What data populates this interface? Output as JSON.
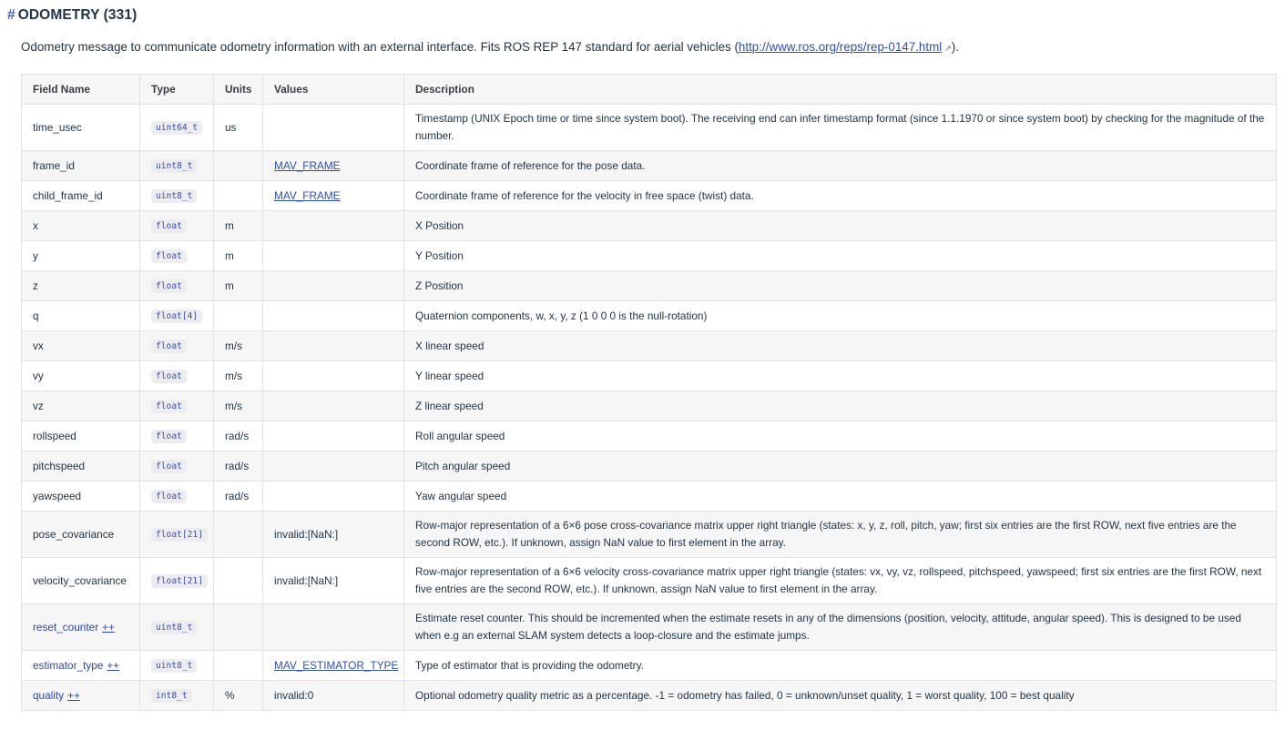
{
  "title": {
    "hash": "#",
    "text": "ODOMETRY (331)"
  },
  "intro": {
    "before": "Odometry message to communicate odometry information with an external interface. Fits ROS REP 147 standard for aerial vehicles (",
    "link": "http://www.ros.org/reps/rep-0147.html",
    "ext_icon": "↗",
    "after": ")."
  },
  "table": {
    "headers": {
      "field": "Field Name",
      "type": "Type",
      "units": "Units",
      "values": "Values",
      "description": "Description"
    },
    "rows": [
      {
        "field": "time_usec",
        "type": "uint64_t",
        "units": "us",
        "values": "",
        "description": "Timestamp (UNIX Epoch time or time since system boot). The receiving end can infer timestamp format (since 1.1.1970 or since system boot) by checking for the magnitude of the number."
      },
      {
        "field": "frame_id",
        "type": "uint8_t",
        "units": "",
        "values": "MAV_FRAME",
        "description": "Coordinate frame of reference for the pose data."
      },
      {
        "field": "child_frame_id",
        "type": "uint8_t",
        "units": "",
        "values": "MAV_FRAME",
        "description": "Coordinate frame of reference for the velocity in free space (twist) data."
      },
      {
        "field": "x",
        "type": "float",
        "units": "m",
        "values": "",
        "description": "X Position"
      },
      {
        "field": "y",
        "type": "float",
        "units": "m",
        "values": "",
        "description": "Y Position"
      },
      {
        "field": "z",
        "type": "float",
        "units": "m",
        "values": "",
        "description": "Z Position"
      },
      {
        "field": "q",
        "type": "float[4]",
        "units": "",
        "values": "",
        "description": "Quaternion components, w, x, y, z (1 0 0 0 is the null-rotation)"
      },
      {
        "field": "vx",
        "type": "float",
        "units": "m/s",
        "values": "",
        "description": "X linear speed"
      },
      {
        "field": "vy",
        "type": "float",
        "units": "m/s",
        "values": "",
        "description": "Y linear speed"
      },
      {
        "field": "vz",
        "type": "float",
        "units": "m/s",
        "values": "",
        "description": "Z linear speed"
      },
      {
        "field": "rollspeed",
        "type": "float",
        "units": "rad/s",
        "values": "",
        "description": "Roll angular speed"
      },
      {
        "field": "pitchspeed",
        "type": "float",
        "units": "rad/s",
        "values": "",
        "description": "Pitch angular speed"
      },
      {
        "field": "yawspeed",
        "type": "float",
        "units": "rad/s",
        "values": "",
        "description": "Yaw angular speed"
      },
      {
        "field": "pose_covariance",
        "type": "float[21]",
        "units": "",
        "values": "invalid:[NaN:]",
        "description": "Row-major representation of a 6×6 pose cross-covariance matrix upper right triangle (states: x, y, z, roll, pitch, yaw; first six entries are the first ROW, next five entries are the second ROW, etc.). If unknown, assign NaN value to first element in the array."
      },
      {
        "field": "velocity_covariance",
        "type": "float[21]",
        "units": "",
        "values": "invalid:[NaN:]",
        "description": "Row-major representation of a 6×6 velocity cross-covariance matrix upper right triangle (states: vx, vy, vz, rollspeed, pitchspeed, yawspeed; first six entries are the first ROW, next five entries are the second ROW, etc.). If unknown, assign NaN value to first element in the array."
      },
      {
        "field": "reset_counter",
        "ext": "++",
        "type": "uint8_t",
        "units": "",
        "values": "",
        "description": "Estimate reset counter. This should be incremented when the estimate resets in any of the dimensions (position, velocity, attitude, angular speed). This is designed to be used when e.g an external SLAM system detects a loop-closure and the estimate jumps."
      },
      {
        "field": "estimator_type",
        "ext": "++",
        "type": "uint8_t",
        "units": "",
        "values": "MAV_ESTIMATOR_TYPE",
        "description": "Type of estimator that is providing the odometry."
      },
      {
        "field": "quality",
        "ext": "++",
        "type": "int8_t",
        "units": "%",
        "values": "invalid:0",
        "description": "Optional odometry quality metric as a percentage. -1 = odometry has failed, 0 = unknown/unset quality, 1 = worst quality, 100 = best quality"
      }
    ]
  }
}
